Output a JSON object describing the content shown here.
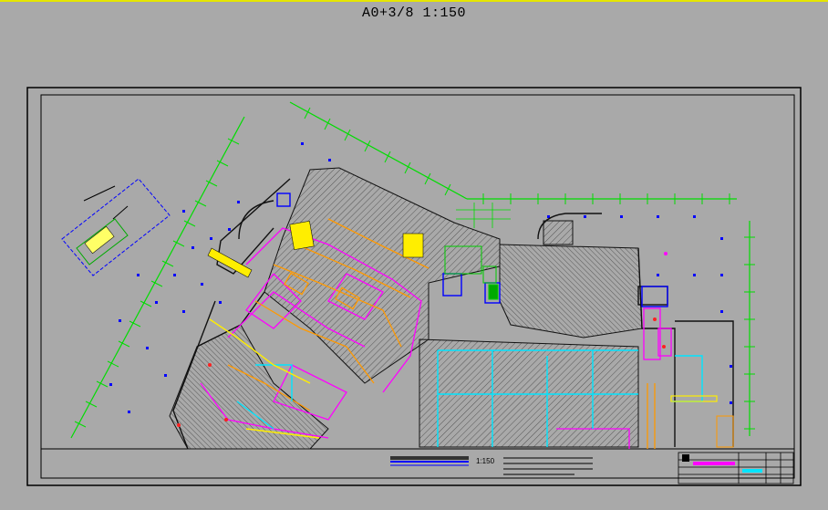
{
  "sheet": {
    "title": "A0+3/8 1:150",
    "drawing_scale": "1:150"
  },
  "colors": {
    "background": "#a9a9a9",
    "frame": "#000000",
    "axis_grid": "#00dd00",
    "walls": "#111111",
    "hatch": "#5a5a5a",
    "magenta": "#ff00ff",
    "orange": "#ff9900",
    "cyan": "#00e5ff",
    "yellow": "#ffff00",
    "blue": "#0000ff",
    "red": "#ff2020"
  }
}
